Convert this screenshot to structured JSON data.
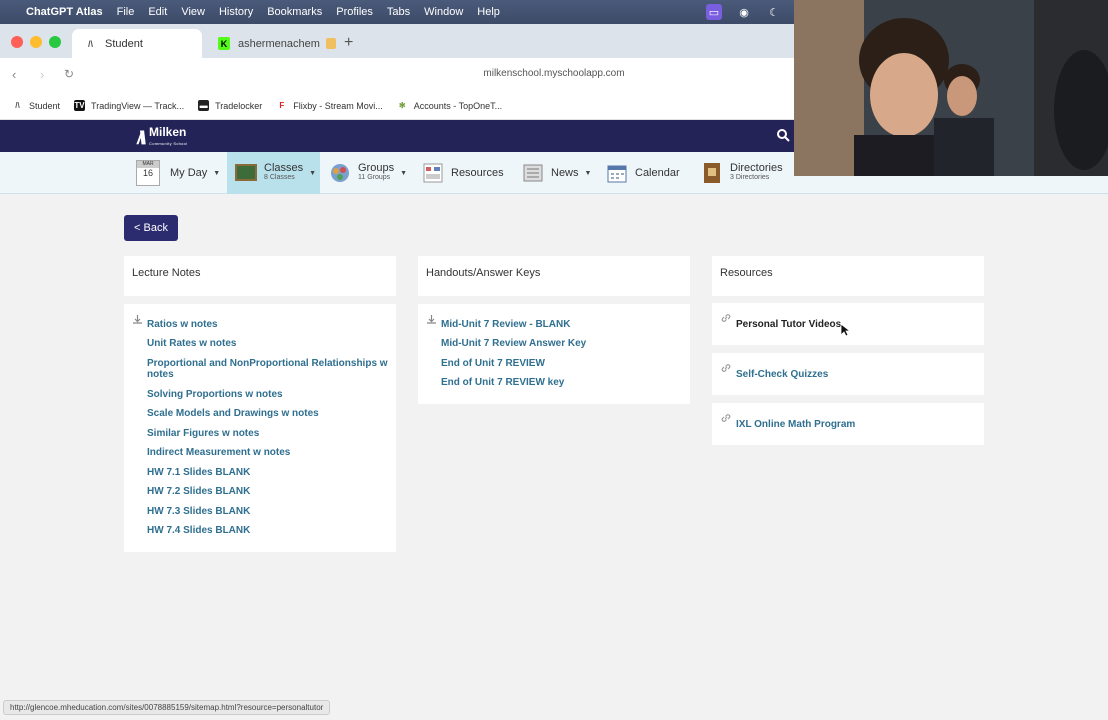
{
  "menubar": {
    "app_name": "ChatGPT Atlas",
    "items": [
      "File",
      "Edit",
      "View",
      "History",
      "Bookmarks",
      "Profiles",
      "Tabs",
      "Window",
      "Help"
    ]
  },
  "tabs": [
    {
      "label": "Student"
    },
    {
      "label": "ashermenachem"
    }
  ],
  "address": {
    "url": "milkenschool.myschoolapp.com"
  },
  "bookmarks": [
    {
      "label": "Student"
    },
    {
      "label": "TradingView — Track..."
    },
    {
      "label": "Tradelocker"
    },
    {
      "label": "Flixby - Stream Movi..."
    },
    {
      "label": "Accounts - TopOneT..."
    }
  ],
  "site": {
    "logo_text": "Milken",
    "logo_sub": "Community School"
  },
  "nav": {
    "myday": {
      "month": "MAR",
      "day": "16",
      "label": "My Day"
    },
    "classes": {
      "label": "Classes",
      "sub": "8 Classes"
    },
    "groups": {
      "label": "Groups",
      "sub": "11 Groups"
    },
    "resources": {
      "label": "Resources"
    },
    "news": {
      "label": "News"
    },
    "calendar": {
      "label": "Calendar"
    },
    "directories": {
      "label": "Directories",
      "sub": "3 Directories"
    }
  },
  "back_label": "< Back",
  "panels": {
    "lecture": {
      "title": "Lecture Notes",
      "links": [
        "Ratios w notes",
        "Unit Rates w notes",
        "Proportional and NonProportional Relationships w notes",
        "Solving Proportions w notes",
        "Scale Models and Drawings w notes",
        "Similar Figures w notes",
        "Indirect Measurement w notes",
        "HW 7.1 Slides BLANK",
        "HW 7.2 Slides BLANK",
        "HW 7.3 Slides BLANK",
        "HW 7.4 Slides BLANK"
      ]
    },
    "handouts": {
      "title": "Handouts/Answer Keys",
      "links": [
        "Mid-Unit 7 Review - BLANK",
        "Mid-Unit 7 Review Answer Key",
        "End of Unit 7 REVIEW",
        "End of Unit 7 REVIEW key"
      ]
    },
    "resources": {
      "title": "Resources",
      "links": [
        "Personal Tutor Videos",
        "Self-Check Quizzes",
        "IXL Online Math Program"
      ]
    }
  },
  "status_url": "http://glencoe.mheducation.com/sites/0078885159/sitemap.html?resource=personaltutor",
  "colors": {
    "header": "#232357",
    "link": "#2f6f8f",
    "nav_active": "#b9e1ec",
    "back_button": "#2b2b70"
  }
}
